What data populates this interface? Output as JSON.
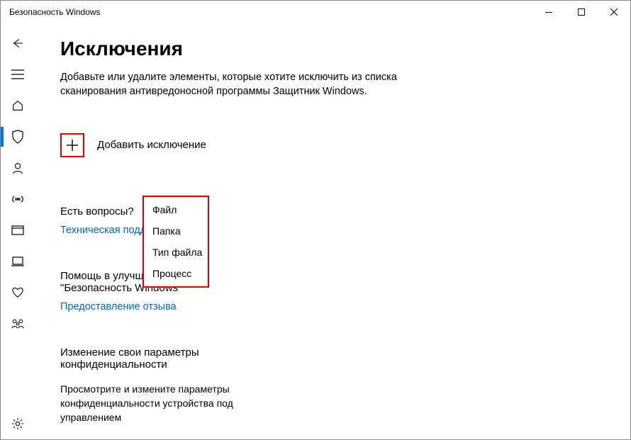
{
  "window": {
    "title": "Безопасность Windows"
  },
  "page": {
    "heading": "Исключения",
    "description": "Добавьте или удалите элементы, которые хотите исключить из списка сканирования антивредоносной программы Защитник Windows."
  },
  "add": {
    "label": "Добавить исключение"
  },
  "menu": {
    "file": "Файл",
    "folder": "Папка",
    "filetype": "Тип файла",
    "process": "Процесс"
  },
  "questions": {
    "heading": "Есть вопросы?",
    "link": "Техническая поддержка"
  },
  "help": {
    "heading": "Помощь в улучшении службы \"Безопасность Windows\"",
    "link": "Предоставление отзыва"
  },
  "privacy": {
    "heading": "Изменение свои параметры конфиденциальности",
    "text": "Просмотрите и измените параметры конфиденциальности устройства под управлением"
  }
}
